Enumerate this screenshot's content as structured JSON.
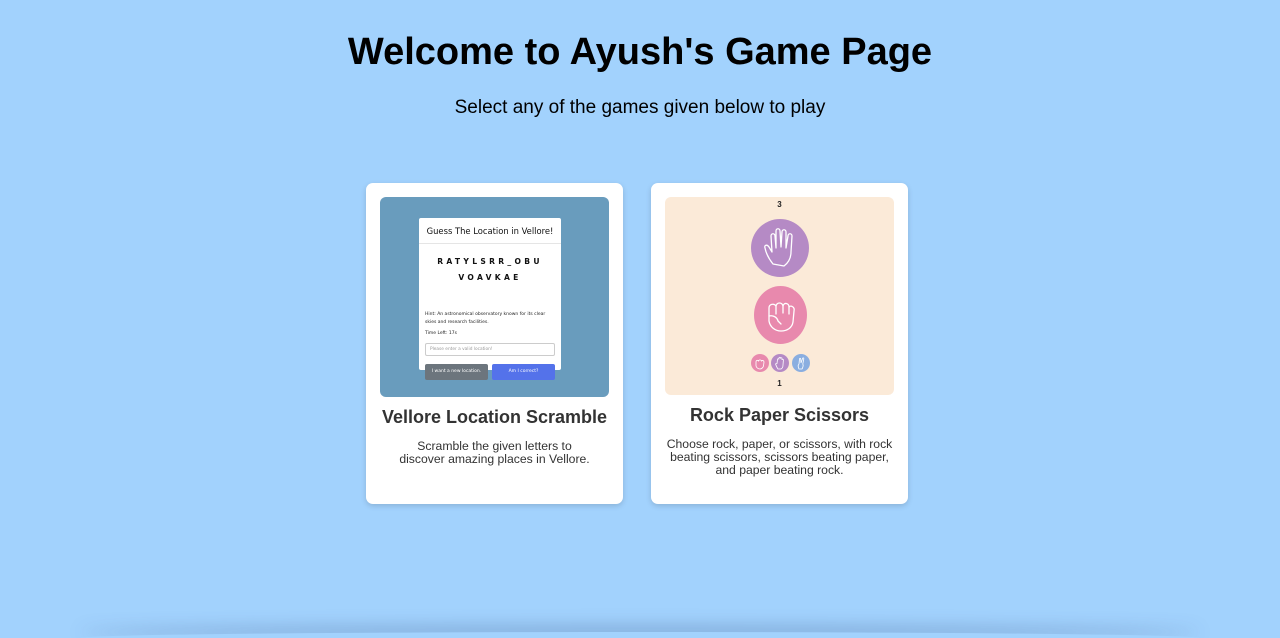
{
  "header": {
    "title": "Welcome to Ayush's Game Page",
    "subtitle": "Select any of the games given below to play"
  },
  "games": [
    {
      "title": "Vellore Location Scramble",
      "description": "Scramble the given letters to discover amazing places in Vellore.",
      "preview": {
        "heading": "Guess The Location in Vellore!",
        "letters_line1": "RATYLSRR_OBU",
        "letters_line2": "VOAVKAE",
        "hint": "Hint: An astronomical observatory known for its clear skies and research facilities.",
        "time_left": "Time Left: 17s",
        "input_placeholder": "Please enter a valid location!",
        "new_location_label": "I want a new location.",
        "check_label": "Am I correct?"
      }
    },
    {
      "title": "Rock Paper Scissors",
      "description": "Choose rock, paper, or scissors, with rock beating scissors, scissors beating paper, and paper beating rock.",
      "preview": {
        "computer_score": "3",
        "player_score": "1",
        "computer_choice_icon": "paper-hand-icon",
        "player_choice_icon": "rock-fist-icon",
        "options": [
          "rock-icon",
          "paper-icon",
          "scissors-icon"
        ]
      }
    }
  ],
  "colors": {
    "background": "#a2d2fd",
    "scramble_thumb": "#699cbd",
    "rps_thumb": "#fbead8",
    "rps_pink": "#e889ad",
    "rps_purple": "#b58ac5",
    "rps_blue": "#8aaee0",
    "check_button": "#5472ea",
    "new_button": "#6c757d"
  }
}
